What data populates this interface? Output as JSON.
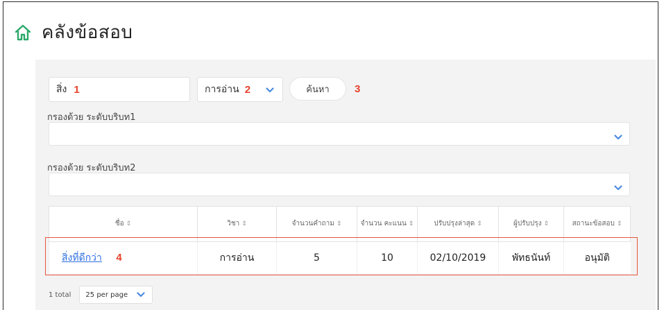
{
  "header": {
    "title": "คลังข้อสอบ",
    "icon": "home-icon",
    "accent": "#2aa86a"
  },
  "search": {
    "value": "สิ่ง",
    "marker": "1"
  },
  "subject_select": {
    "selected": "การอ่าน",
    "marker": "2"
  },
  "search_button": {
    "label": "ค้นหา",
    "marker": "3"
  },
  "filters": [
    {
      "label": "กรองด้วย ระดับบริบท1",
      "value": ""
    },
    {
      "label": "กรองด้วย ระดับบริบท2",
      "value": ""
    }
  ],
  "table": {
    "columns": [
      {
        "label": "ชื่อ",
        "sort": "⇕"
      },
      {
        "label": "วิชา",
        "sort": "⇕"
      },
      {
        "label": "จำนวนคำถาม",
        "sort": "⇕"
      },
      {
        "label": "จำนวน คะแนน",
        "sort": "⇕"
      },
      {
        "label": "ปรับปรุงล่าสุด",
        "sort": "⇕"
      },
      {
        "label": "ผู้ปรับปรุง",
        "sort": "⇕"
      },
      {
        "label": "สถานะข้อสอบ",
        "sort": "⇕"
      }
    ],
    "rows": [
      {
        "name": "สิ่งที่ดีกว่า",
        "marker": "4",
        "subject": "การอ่าน",
        "questions": "5",
        "score": "10",
        "updated": "02/10/2019",
        "updater": "พัทธนันท์",
        "status": "อนุมัติ"
      }
    ]
  },
  "pagination": {
    "total": "1 total",
    "page_size": "25 per page"
  },
  "colors": {
    "marker": "#e8412c",
    "link": "#2e6fe0",
    "chevron": "#4a8ae0",
    "panel": "#f3f3f3"
  }
}
